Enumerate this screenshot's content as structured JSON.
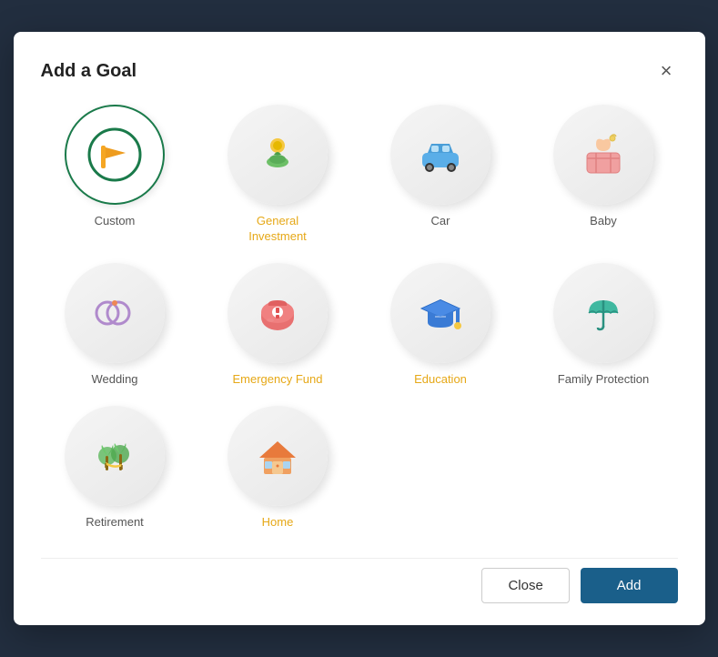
{
  "modal": {
    "title": "Add a Goal",
    "close_label": "×"
  },
  "goals": [
    {
      "id": "custom",
      "label": "Custom",
      "selected": true,
      "highlight": false
    },
    {
      "id": "general-investment",
      "label": "General Investment",
      "selected": false,
      "highlight": true
    },
    {
      "id": "car",
      "label": "Car",
      "selected": false,
      "highlight": false
    },
    {
      "id": "baby",
      "label": "Baby",
      "selected": false,
      "highlight": false
    },
    {
      "id": "wedding",
      "label": "Wedding",
      "selected": false,
      "highlight": false
    },
    {
      "id": "emergency-fund",
      "label": "Emergency Fund",
      "selected": false,
      "highlight": true
    },
    {
      "id": "education",
      "label": "Education",
      "selected": false,
      "highlight": true
    },
    {
      "id": "family-protection",
      "label": "Family Protection",
      "selected": false,
      "highlight": false
    },
    {
      "id": "retirement",
      "label": "Retirement",
      "selected": false,
      "highlight": false
    },
    {
      "id": "home",
      "label": "Home",
      "selected": false,
      "highlight": true
    }
  ],
  "footer": {
    "close_label": "Close",
    "add_label": "Add"
  }
}
